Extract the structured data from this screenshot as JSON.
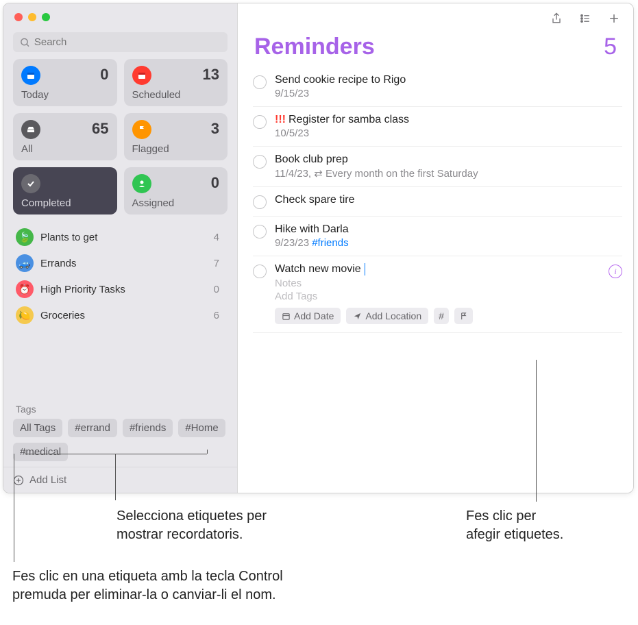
{
  "search": {
    "placeholder": "Search"
  },
  "smart": {
    "today": {
      "label": "Today",
      "count": "0"
    },
    "scheduled": {
      "label": "Scheduled",
      "count": "13"
    },
    "all": {
      "label": "All",
      "count": "65"
    },
    "flagged": {
      "label": "Flagged",
      "count": "3"
    },
    "completed": {
      "label": "Completed",
      "count": ""
    },
    "assigned": {
      "label": "Assigned",
      "count": "0"
    }
  },
  "lists": [
    {
      "name": "Plants to get",
      "count": "4",
      "color": "#45b749",
      "glyph": "🍃"
    },
    {
      "name": "Errands",
      "count": "7",
      "color": "#4a90e2",
      "glyph": "🚙"
    },
    {
      "name": "High Priority Tasks",
      "count": "0",
      "color": "#ff5a68",
      "glyph": "⏰"
    },
    {
      "name": "Groceries",
      "count": "6",
      "color": "#f5c94e",
      "glyph": "🍋"
    }
  ],
  "tags_header": "Tags",
  "tags": [
    "All Tags",
    "#errand",
    "#friends",
    "#Home",
    "#medical"
  ],
  "add_list": "Add List",
  "header": {
    "title": "Reminders",
    "count": "5"
  },
  "items": [
    {
      "title": "Send cookie recipe to Rigo",
      "sub": "9/15/23"
    },
    {
      "priority": "!!!",
      "title": "Register for samba class",
      "sub": "10/5/23"
    },
    {
      "title": "Book club prep",
      "sub": "11/4/23, ⇄ Every month on the first Saturday"
    },
    {
      "title": "Check spare tire"
    },
    {
      "title": "Hike with Darla",
      "sub_pre": "9/23/23 ",
      "tag": "#friends"
    }
  ],
  "editing": {
    "title": "Watch new movie",
    "notes": "Notes",
    "add_tags": "Add Tags",
    "add_date": "Add Date",
    "add_location": "Add Location"
  },
  "callouts": {
    "a": "Selecciona etiquetes per\nmostrar recordatoris.",
    "b": "Fes clic per\nafegir etiquetes.",
    "c": "Fes clic en una etiqueta amb la tecla Control\npremuda per eliminar-la o canviar-li el nom."
  }
}
